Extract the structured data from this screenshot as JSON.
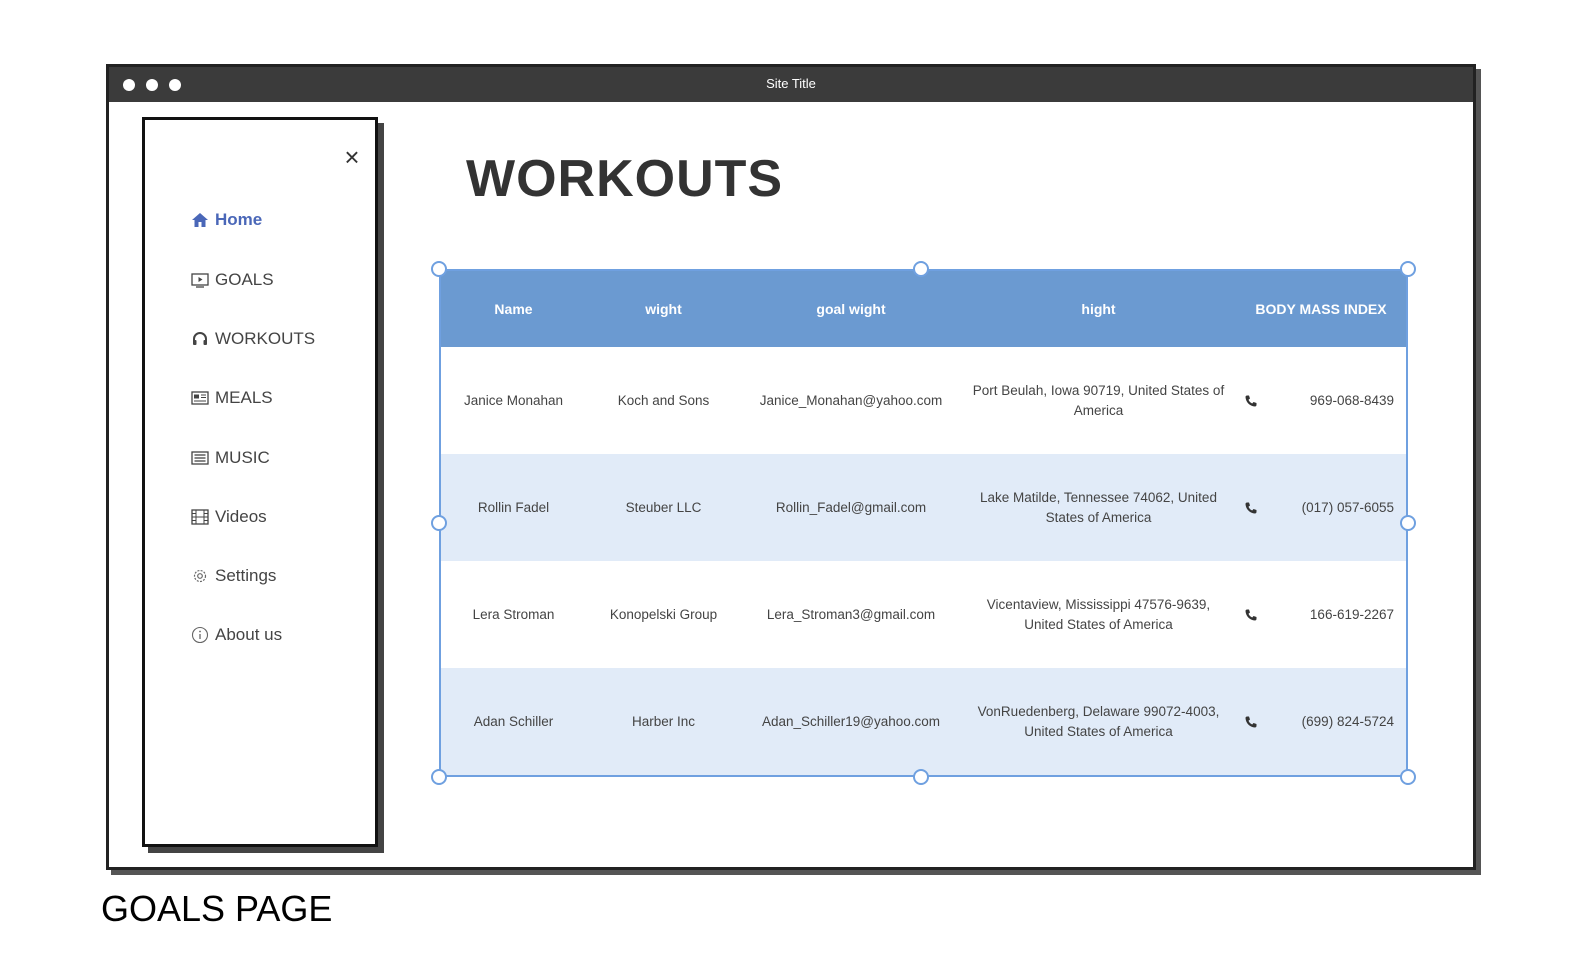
{
  "window": {
    "title": "Site Title"
  },
  "sidebar": {
    "items": [
      {
        "label": "Home",
        "icon": "home-icon",
        "active": true
      },
      {
        "label": "GOALS",
        "icon": "video-play-icon"
      },
      {
        "label": "WORKOUTS",
        "icon": "headphones-icon"
      },
      {
        "label": "MEALS",
        "icon": "newspaper-icon"
      },
      {
        "label": "MUSIC",
        "icon": "list-box-icon"
      },
      {
        "label": "Videos",
        "icon": "film-icon"
      },
      {
        "label": "Settings",
        "icon": "gear-icon"
      },
      {
        "label": "About us",
        "icon": "info-icon"
      }
    ]
  },
  "main": {
    "title": "WORKOUTS",
    "table": {
      "headers": [
        "Name",
        "wight",
        "goal wight",
        "hight",
        "BODY MASS INDEX"
      ],
      "rows": [
        {
          "name": "Janice Monahan",
          "wight": "Koch and Sons",
          "goal": "Janice_Monahan@yahoo.com",
          "hight": "Port Beulah, Iowa 90719, United States of America",
          "phone": "969-068-8439"
        },
        {
          "name": "Rollin Fadel",
          "wight": "Steuber LLC",
          "goal": "Rollin_Fadel@gmail.com",
          "hight": "Lake Matilde, Tennessee 74062, United States of America",
          "phone": "(017) 057-6055"
        },
        {
          "name": "Lera Stroman",
          "wight": "Konopelski Group",
          "goal": "Lera_Stroman3@gmail.com",
          "hight": "Vicentaview, Mississippi 47576-9639, United States of America",
          "phone": "166-619-2267"
        },
        {
          "name": "Adan Schiller",
          "wight": "Harber Inc",
          "goal": "Adan_Schiller19@yahoo.com",
          "hight": "VonRuedenberg, Delaware 99072-4003, United States of America",
          "phone": "(699) 824-5724"
        }
      ]
    }
  },
  "caption": "GOALS PAGE",
  "colors": {
    "header_bg": "#6b9ad1",
    "stripe": "#e1ebf8",
    "active_nav": "#4a67b8",
    "titlebar": "#3b3b3b"
  }
}
